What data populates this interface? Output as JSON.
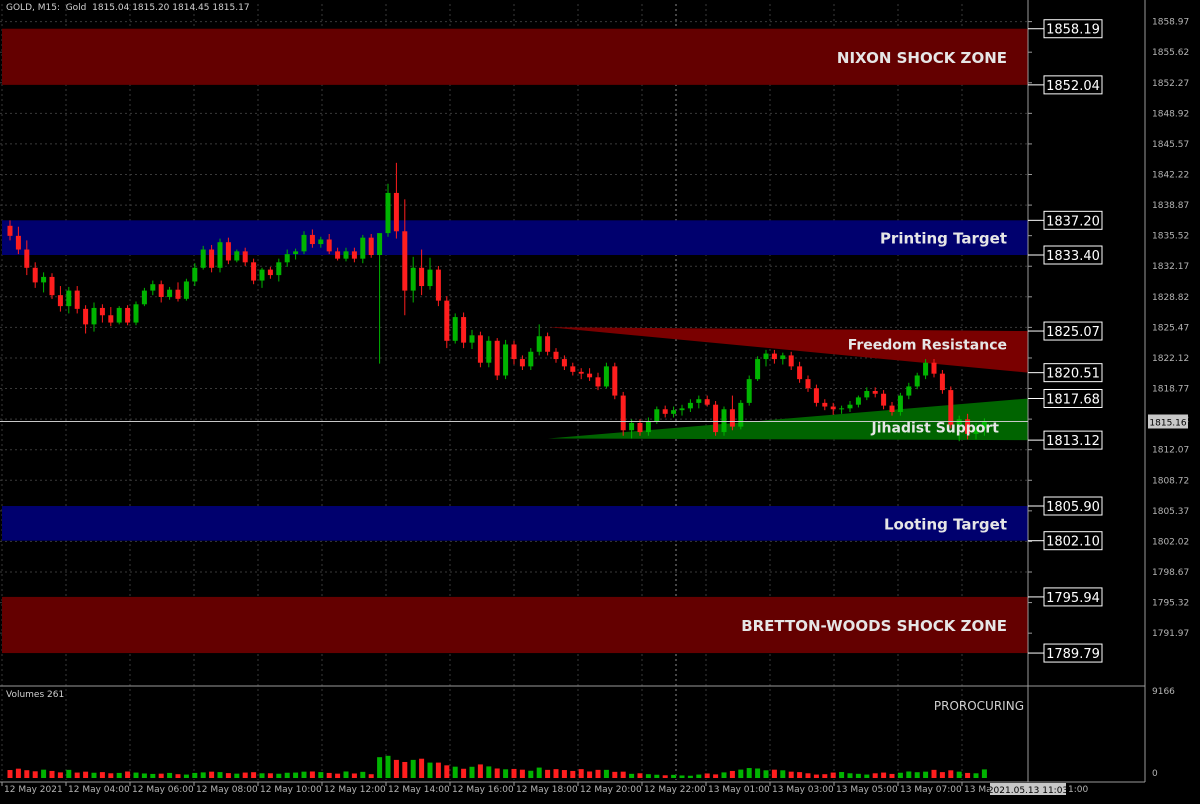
{
  "header": {
    "symbol_line": "GOLD, M15:  Gold  1815.04 1815.20 1814.45 1815.17"
  },
  "volume_panel": {
    "label": "Volumes 261",
    "watermark": "PROROCURING",
    "axis_max": "9166",
    "axis_min": "0"
  },
  "colors": {
    "background": "#000000",
    "grid": "#3a3a3a",
    "bull": "#00b400",
    "bear": "#ff1e1e",
    "zone_red": "#640000",
    "zone_blue": "#00006e",
    "triangle_red": "#7a0000",
    "triangle_green": "#006400",
    "axis_text": "#b4b4b4"
  },
  "chart_data": {
    "type": "candlestick",
    "timeframe": "M15",
    "ylim": [
      1786.4,
      1860.9
    ],
    "y_ticks": [
      "1858.97",
      "1855.62",
      "1852.27",
      "1848.92",
      "1845.57",
      "1842.22",
      "1838.87",
      "1835.52",
      "1832.17",
      "1828.82",
      "1825.47",
      "1822.12",
      "1818.77",
      "1815.42",
      "1812.07",
      "1808.72",
      "1805.37",
      "1802.02",
      "1798.67",
      "1795.32",
      "1791.97"
    ],
    "x_ticks": [
      "12 May 2021",
      "12 May 04:00",
      "12 May 06:00",
      "12 May 08:00",
      "12 May 10:00",
      "12 May 12:00",
      "12 May 14:00",
      "12 May 16:00",
      "12 May 18:00",
      "12 May 20:00",
      "12 May 22:00",
      "13 May 01:00",
      "13 May 03:00",
      "13 May 05:00",
      "13 May 07:00",
      "13 Ma"
    ],
    "current_price": "1815.16",
    "current_time_label": "2021.05.13 11:03",
    "time_tail": "1:00",
    "zones": [
      {
        "label": "NIXON SHOCK ZONE",
        "top": 1858.19,
        "bottom": 1852.04,
        "top_label": "1858.19",
        "bottom_label": "1852.04",
        "color": "red"
      },
      {
        "label": "Printing Target",
        "top": 1837.2,
        "bottom": 1833.4,
        "top_label": "1837.20",
        "bottom_label": "1833.40",
        "color": "blue"
      },
      {
        "label": "Looting Target",
        "top": 1805.9,
        "bottom": 1802.1,
        "top_label": "1805.90",
        "bottom_label": "1802.10",
        "color": "blue"
      },
      {
        "label": "BRETTON-WOODS SHOCK ZONE",
        "top": 1795.94,
        "bottom": 1789.79,
        "top_label": "1795.94",
        "bottom_label": "1789.79",
        "color": "red"
      }
    ],
    "triangles": [
      {
        "label": "Freedom Resistance",
        "level_label": "1825.07",
        "color": "red"
      },
      {
        "label": "Jihadist Support",
        "level_label": "1813.12",
        "color": "green"
      }
    ],
    "extra_levels": [
      {
        "value": 1820.51,
        "label": "1820.51"
      },
      {
        "value": 1817.68,
        "label": "1817.68"
      }
    ],
    "candles": [
      [
        1836.6,
        1837.2,
        1835.0,
        1835.5
      ],
      [
        1835.5,
        1836.5,
        1833.5,
        1834.0
      ],
      [
        1834.0,
        1835.0,
        1831.2,
        1832.0
      ],
      [
        1832.0,
        1832.6,
        1829.8,
        1830.4
      ],
      [
        1830.4,
        1831.5,
        1829.3,
        1831.0
      ],
      [
        1831.0,
        1831.4,
        1828.6,
        1829.0
      ],
      [
        1829.0,
        1830.0,
        1827.2,
        1827.8
      ],
      [
        1827.8,
        1829.9,
        1827.0,
        1829.5
      ],
      [
        1829.5,
        1830.0,
        1827.0,
        1827.5
      ],
      [
        1827.5,
        1827.9,
        1824.8,
        1825.8
      ],
      [
        1825.8,
        1828.2,
        1825.0,
        1827.6
      ],
      [
        1827.6,
        1828.0,
        1826.0,
        1826.8
      ],
      [
        1826.8,
        1827.7,
        1825.6,
        1826.0
      ],
      [
        1826.0,
        1827.8,
        1825.8,
        1827.6
      ],
      [
        1827.6,
        1827.9,
        1825.7,
        1826.0
      ],
      [
        1826.0,
        1828.3,
        1825.7,
        1828.0
      ],
      [
        1828.0,
        1829.8,
        1827.8,
        1829.5
      ],
      [
        1829.5,
        1830.6,
        1829.0,
        1830.2
      ],
      [
        1830.2,
        1830.6,
        1828.2,
        1828.8
      ],
      [
        1828.8,
        1829.9,
        1828.5,
        1829.6
      ],
      [
        1829.6,
        1830.4,
        1828.3,
        1828.6
      ],
      [
        1828.6,
        1830.8,
        1828.4,
        1830.5
      ],
      [
        1830.5,
        1832.5,
        1830.0,
        1832.0
      ],
      [
        1832.0,
        1834.4,
        1831.8,
        1834.0
      ],
      [
        1834.0,
        1834.5,
        1831.5,
        1832.0
      ],
      [
        1832.0,
        1835.2,
        1831.5,
        1834.8
      ],
      [
        1834.8,
        1835.3,
        1832.4,
        1832.8
      ],
      [
        1832.8,
        1834.0,
        1832.6,
        1833.8
      ],
      [
        1833.8,
        1834.2,
        1832.2,
        1832.6
      ],
      [
        1832.6,
        1833.0,
        1830.2,
        1830.6
      ],
      [
        1830.6,
        1832.0,
        1829.8,
        1831.8
      ],
      [
        1831.8,
        1832.1,
        1830.8,
        1831.2
      ],
      [
        1831.2,
        1833.0,
        1830.5,
        1832.6
      ],
      [
        1832.6,
        1834.0,
        1832.1,
        1833.5
      ],
      [
        1833.5,
        1834.1,
        1832.9,
        1833.8
      ],
      [
        1833.8,
        1836.0,
        1833.5,
        1835.6
      ],
      [
        1835.6,
        1836.2,
        1834.2,
        1834.6
      ],
      [
        1834.6,
        1835.4,
        1834.2,
        1835.1
      ],
      [
        1835.1,
        1835.7,
        1833.5,
        1833.8
      ],
      [
        1833.8,
        1834.2,
        1832.8,
        1833.0
      ],
      [
        1833.0,
        1834.2,
        1832.7,
        1833.8
      ],
      [
        1833.8,
        1834.2,
        1832.6,
        1833.0
      ],
      [
        1833.0,
        1835.6,
        1832.5,
        1835.3
      ],
      [
        1835.3,
        1835.7,
        1833.1,
        1833.4
      ],
      [
        1833.4,
        1834.0,
        1821.5,
        1835.8
      ],
      [
        1835.8,
        1841.2,
        1835.4,
        1840.2
      ],
      [
        1840.2,
        1843.5,
        1835.2,
        1836.0
      ],
      [
        1836.0,
        1839.5,
        1826.8,
        1829.5
      ],
      [
        1829.5,
        1833.2,
        1828.2,
        1832.0
      ],
      [
        1832.0,
        1834.0,
        1829.0,
        1830.0
      ],
      [
        1830.0,
        1833.1,
        1829.6,
        1831.8
      ],
      [
        1831.8,
        1832.2,
        1827.8,
        1828.4
      ],
      [
        1828.4,
        1828.9,
        1823.2,
        1824.0
      ],
      [
        1824.0,
        1827.0,
        1823.7,
        1826.6
      ],
      [
        1826.6,
        1827.1,
        1823.2,
        1823.8
      ],
      [
        1823.8,
        1825.2,
        1823.1,
        1824.6
      ],
      [
        1824.6,
        1825.0,
        1821.1,
        1821.6
      ],
      [
        1821.6,
        1824.5,
        1821.1,
        1824.0
      ],
      [
        1824.0,
        1824.3,
        1819.7,
        1820.2
      ],
      [
        1820.2,
        1824.1,
        1819.8,
        1823.6
      ],
      [
        1823.6,
        1824.0,
        1821.4,
        1822.0
      ],
      [
        1822.0,
        1822.4,
        1820.8,
        1821.2
      ],
      [
        1821.2,
        1823.2,
        1820.8,
        1822.8
      ],
      [
        1822.8,
        1825.8,
        1822.4,
        1824.5
      ],
      [
        1824.5,
        1824.9,
        1822.4,
        1822.8
      ],
      [
        1822.8,
        1823.2,
        1821.6,
        1822.0
      ],
      [
        1822.0,
        1822.4,
        1820.8,
        1821.2
      ],
      [
        1821.2,
        1821.6,
        1820.2,
        1820.6
      ],
      [
        1820.6,
        1821.0,
        1819.8,
        1820.4
      ],
      [
        1820.4,
        1821.0,
        1819.6,
        1820.0
      ],
      [
        1820.0,
        1820.5,
        1818.6,
        1819.0
      ],
      [
        1819.0,
        1821.6,
        1818.8,
        1821.2
      ],
      [
        1821.2,
        1821.6,
        1817.6,
        1818.0
      ],
      [
        1818.0,
        1818.4,
        1813.6,
        1814.2
      ],
      [
        1814.2,
        1815.4,
        1813.3,
        1815.0
      ],
      [
        1815.0,
        1815.4,
        1813.6,
        1814.0
      ],
      [
        1814.0,
        1815.6,
        1813.6,
        1815.2
      ],
      [
        1815.2,
        1816.8,
        1814.9,
        1816.5
      ],
      [
        1816.5,
        1816.9,
        1815.6,
        1816.0
      ],
      [
        1816.0,
        1816.8,
        1815.6,
        1816.4
      ],
      [
        1816.4,
        1817.0,
        1815.8,
        1816.6
      ],
      [
        1816.6,
        1817.6,
        1816.2,
        1817.2
      ],
      [
        1817.2,
        1818.0,
        1816.6,
        1817.6
      ],
      [
        1817.6,
        1818.0,
        1816.8,
        1817.0
      ],
      [
        1817.0,
        1817.4,
        1813.6,
        1814.0
      ],
      [
        1814.0,
        1816.8,
        1813.6,
        1816.5
      ],
      [
        1816.5,
        1818.0,
        1814.2,
        1814.6
      ],
      [
        1814.6,
        1817.5,
        1814.3,
        1817.2
      ],
      [
        1817.2,
        1820.2,
        1816.9,
        1819.8
      ],
      [
        1819.8,
        1822.3,
        1819.6,
        1822.0
      ],
      [
        1822.0,
        1823.0,
        1821.2,
        1822.6
      ],
      [
        1822.6,
        1823.0,
        1821.5,
        1822.0
      ],
      [
        1822.0,
        1822.7,
        1821.4,
        1822.4
      ],
      [
        1822.4,
        1822.8,
        1820.8,
        1821.2
      ],
      [
        1821.2,
        1821.7,
        1819.4,
        1819.8
      ],
      [
        1819.8,
        1820.2,
        1818.4,
        1818.8
      ],
      [
        1818.8,
        1819.2,
        1816.8,
        1817.2
      ],
      [
        1817.2,
        1817.6,
        1816.4,
        1816.8
      ],
      [
        1816.8,
        1817.2,
        1815.9,
        1816.5
      ],
      [
        1816.5,
        1816.9,
        1816.0,
        1816.6
      ],
      [
        1816.6,
        1817.4,
        1816.2,
        1817.0
      ],
      [
        1817.0,
        1818.0,
        1816.7,
        1817.8
      ],
      [
        1817.8,
        1818.9,
        1817.5,
        1818.5
      ],
      [
        1818.5,
        1818.9,
        1817.8,
        1818.2
      ],
      [
        1818.2,
        1818.6,
        1816.5,
        1816.9
      ],
      [
        1816.9,
        1817.3,
        1815.8,
        1816.2
      ],
      [
        1816.2,
        1818.3,
        1815.8,
        1818.0
      ],
      [
        1818.0,
        1819.4,
        1817.6,
        1819.0
      ],
      [
        1819.0,
        1820.5,
        1818.7,
        1820.2
      ],
      [
        1820.2,
        1822.0,
        1819.8,
        1821.6
      ],
      [
        1821.6,
        1822.0,
        1820.0,
        1820.4
      ],
      [
        1820.4,
        1820.8,
        1818.2,
        1818.6
      ],
      [
        1818.6,
        1819.0,
        1814.4,
        1814.8
      ],
      [
        1814.8,
        1815.8,
        1813.0,
        1815.4
      ],
      [
        1815.4,
        1816.0,
        1813.2,
        1813.8
      ],
      [
        1813.8,
        1815.0,
        1813.2,
        1814.4
      ],
      [
        1814.4,
        1815.5,
        1813.6,
        1815.2
      ]
    ],
    "volumes": [
      880,
      1030,
      860,
      740,
      920,
      780,
      620,
      900,
      600,
      700,
      580,
      650,
      520,
      560,
      720,
      600,
      500,
      450,
      480,
      560,
      420,
      380,
      560,
      620,
      700,
      650,
      540,
      480,
      600,
      640,
      520,
      520,
      470,
      580,
      600,
      700,
      720,
      650,
      560,
      480,
      720,
      500,
      680,
      420,
      2300,
      2450,
      2000,
      1770,
      2000,
      2130,
      1700,
      1700,
      1400,
      1250,
      1020,
      1240,
      1500,
      1280,
      1050,
      960,
      1000,
      920,
      800,
      1150,
      900,
      980,
      880,
      780,
      980,
      720,
      900,
      900,
      680,
      700,
      460,
      520,
      420,
      360,
      300,
      350,
      280,
      250,
      380,
      500,
      400,
      620,
      780,
      930,
      1100,
      1050,
      850,
      920,
      850,
      700,
      650,
      520,
      380,
      420,
      600,
      660,
      520,
      460,
      380,
      520,
      600,
      450,
      580,
      720,
      640,
      700,
      900,
      650,
      850,
      700,
      560,
      520,
      950
    ]
  }
}
